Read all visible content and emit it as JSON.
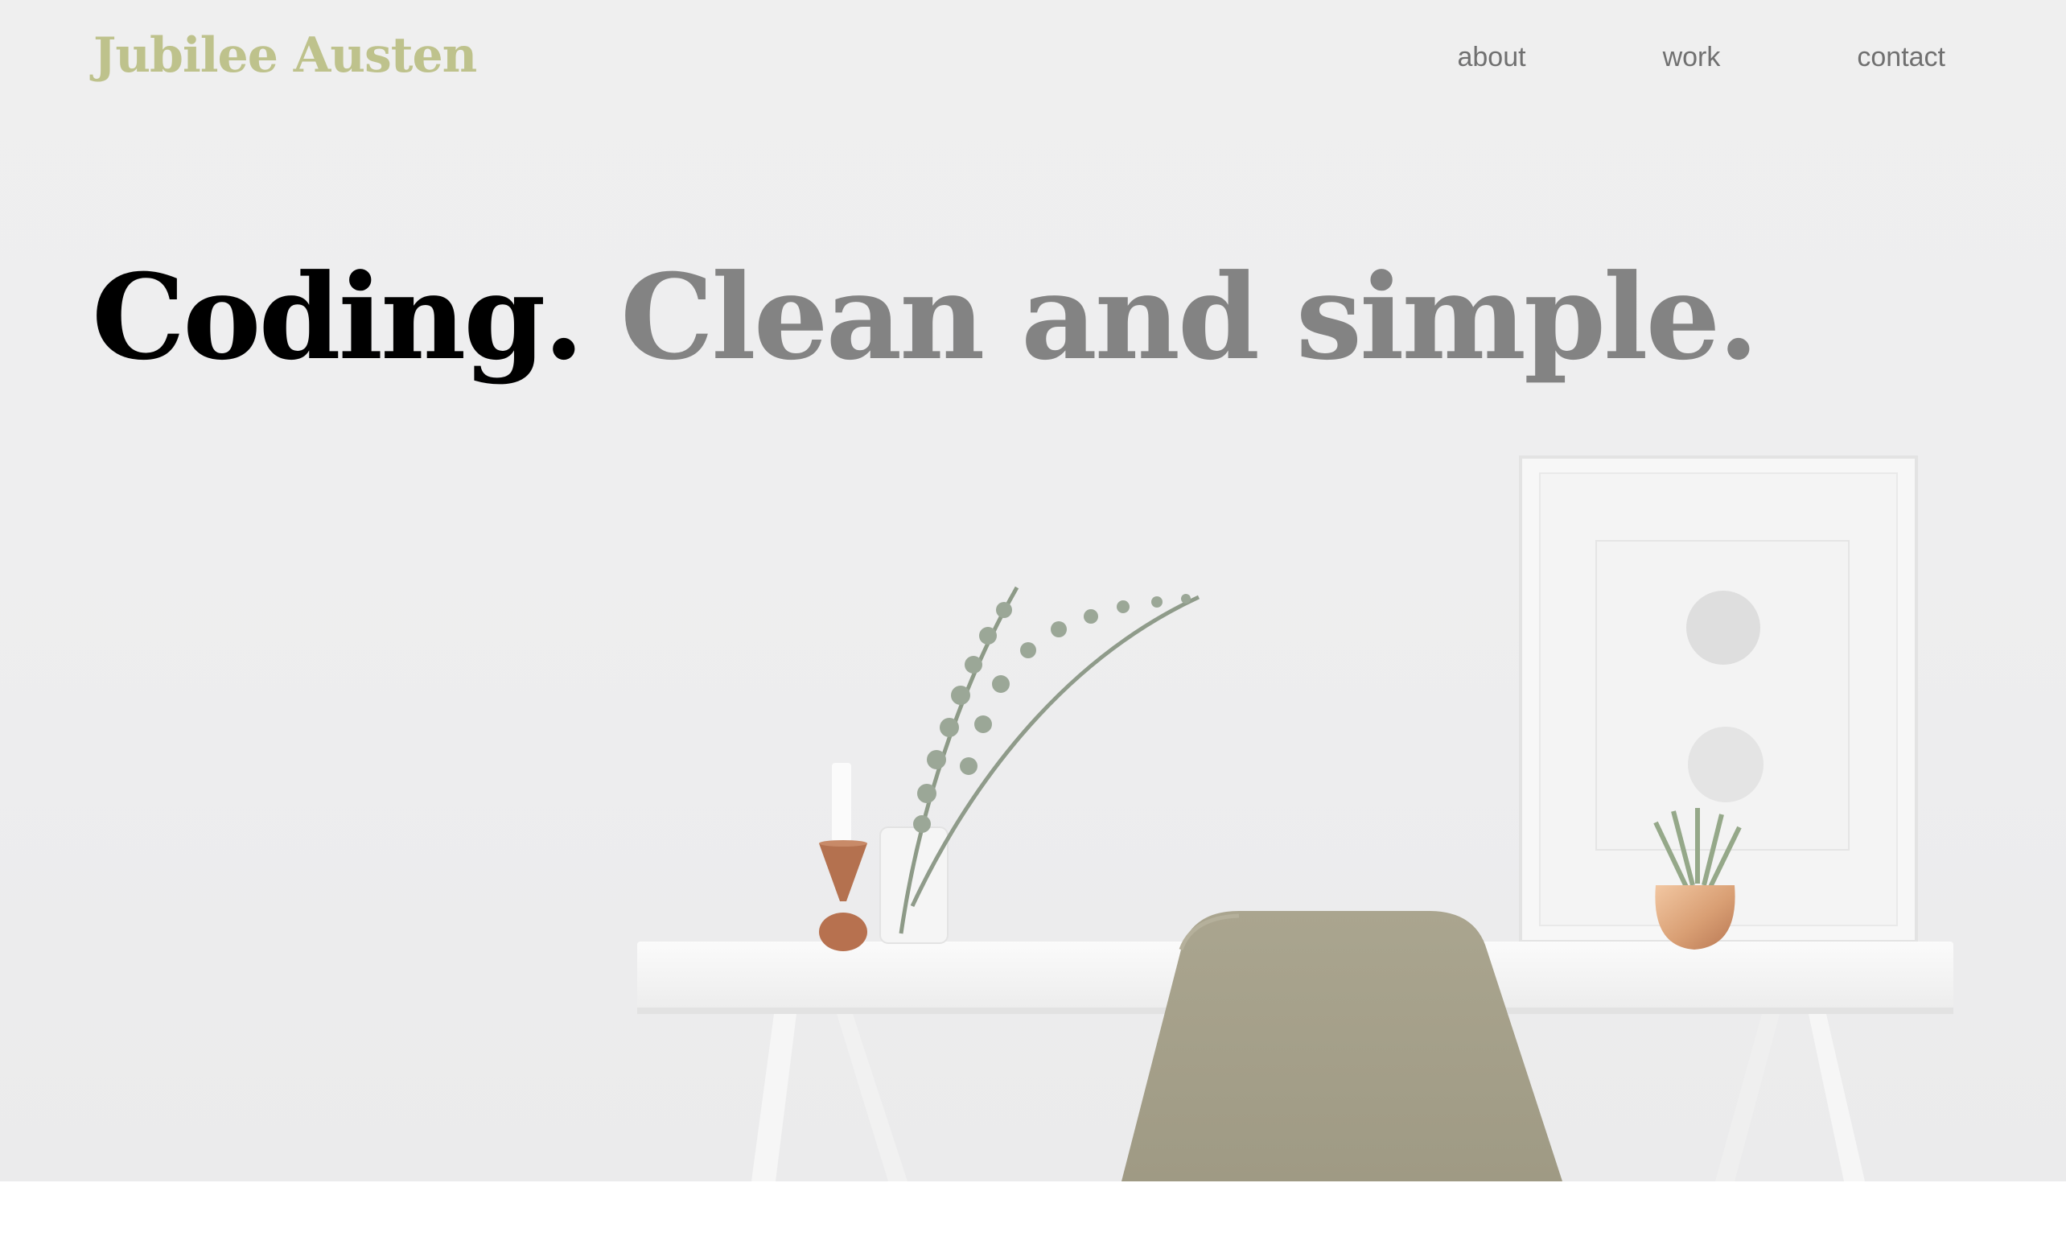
{
  "site": {
    "brand": "Jubilee Austen"
  },
  "nav": {
    "items": [
      {
        "label": "about"
      },
      {
        "label": "work"
      },
      {
        "label": "contact"
      }
    ]
  },
  "hero": {
    "headline_strong": "Coding.",
    "headline_soft": "Clean and simple."
  },
  "colors": {
    "brand": "#bec28c",
    "nav_text": "#707070",
    "headline_strong": "#000000",
    "headline_soft": "#838383",
    "chair": "#a59f86"
  },
  "icons": [
    "desk-illustration",
    "chair-illustration",
    "frame-illustration",
    "plant-illustration",
    "candle-illustration"
  ]
}
